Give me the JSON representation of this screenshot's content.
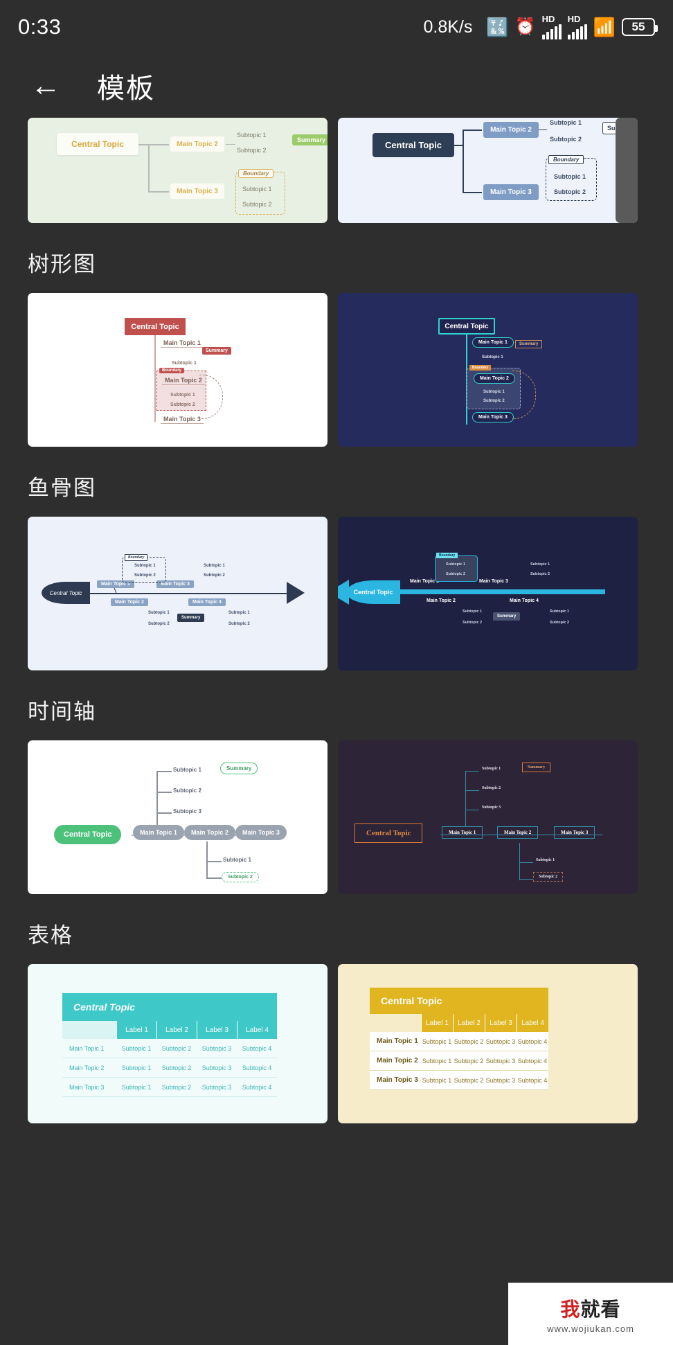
{
  "status_bar": {
    "time": "0:33",
    "net_speed": "0.8K/s",
    "icons": [
      "dnd-moon-icon",
      "bluetooth-icon",
      "alarm-icon",
      "signal-hd-1-icon",
      "signal-hd-2-icon",
      "wifi-icon",
      "battery-icon"
    ],
    "hd_label_1": "HD",
    "hd_label_2": "HD",
    "battery_percent": "55"
  },
  "app_bar": {
    "back_icon": "back-arrow-icon",
    "title": "模板"
  },
  "sections": [
    {
      "id": "mindmap-partial",
      "title": "",
      "cards": [
        {
          "id": "mindmap-green",
          "theme_bg": "#e8f0e4",
          "central": "Central Topic",
          "mains": [
            "Main Topic 2",
            "Main Topic 3"
          ],
          "subs": [
            "Subtopic 1",
            "Subtopic 2",
            "Subtopic 1",
            "Subtopic 2"
          ],
          "summary": "Summary",
          "boundary": "Boundary"
        },
        {
          "id": "mindmap-blue",
          "theme_bg": "#eef3fb",
          "central": "Central Topic",
          "mains": [
            "Main Topic 2",
            "Main Topic 3"
          ],
          "subs": [
            "Subtopic 1",
            "Subtopic 2",
            "Subtopic 1",
            "Subtopic 2"
          ],
          "summary": "Summary",
          "boundary": "Boundary"
        }
      ]
    },
    {
      "id": "tree",
      "title": "树形图",
      "cards": [
        {
          "id": "tree-light",
          "theme_bg": "#ffffff",
          "accent": "#c0504d",
          "central": "Central Topic",
          "mains": [
            "Main Topic 1",
            "Main Topic 2",
            "Main Topic 3"
          ],
          "subs": [
            "Subtopic 1",
            "Subtopic 1",
            "Subtopic 2"
          ],
          "summary": "Summary",
          "boundary": "Boundary"
        },
        {
          "id": "tree-dark",
          "theme_bg": "#262b5e",
          "accent": "#2fd4cf",
          "central": "Central Topic",
          "mains": [
            "Main Topic 1",
            "Main Topic 2",
            "Main Topic 3"
          ],
          "subs": [
            "Subtopic 1",
            "Subtopic 1",
            "Subtopic 2"
          ],
          "summary": "Summary",
          "boundary": "Boundary"
        }
      ]
    },
    {
      "id": "fishbone",
      "title": "鱼骨图",
      "cards": [
        {
          "id": "fishbone-light",
          "theme_bg": "#edf2fa",
          "accent": "#2e3a52",
          "central": "Central Topic",
          "mains": [
            "Main Topic 1",
            "Main Topic 3",
            "Main Topic 2",
            "Main Topic 4"
          ],
          "subs": [
            "Subtopic 1",
            "Subtopic 2"
          ],
          "summary": "Summary",
          "boundary": "Boundary"
        },
        {
          "id": "fishbone-dark",
          "theme_bg": "#1e2142",
          "accent": "#2ab6e0",
          "central": "Central Topic",
          "mains": [
            "Main Topic 1",
            "Main Topic 3",
            "Main Topic 2",
            "Main Topic 4"
          ],
          "subs": [
            "Subtopic 1",
            "Subtopic 2"
          ],
          "summary": "Summary",
          "boundary": "Boundary"
        }
      ]
    },
    {
      "id": "timeline",
      "title": "时间轴",
      "cards": [
        {
          "id": "timeline-light",
          "theme_bg": "#ffffff",
          "accent": "#4cc17a",
          "central": "Central Topic",
          "mains": [
            "Main Topic 1",
            "Main Topic 2",
            "Main Topic 3"
          ],
          "subs": [
            "Subtopic 1",
            "Subtopic 2",
            "Subtopic 3",
            "Subtopic 1",
            "Subtopic 2"
          ],
          "summary": "Summary"
        },
        {
          "id": "timeline-dark",
          "theme_bg": "#2e2438",
          "accent": "#d97a36",
          "central": "Central Topic",
          "mains": [
            "Main Topic 1",
            "Main Topic 2",
            "Main Topic 3"
          ],
          "subs": [
            "Subtopic 1",
            "Subtopic 2",
            "Subtopic 3",
            "Subtopic 1",
            "Subtopic 2"
          ],
          "summary": "Summary"
        }
      ]
    },
    {
      "id": "table",
      "title": "表格",
      "cards": [
        {
          "id": "table-teal",
          "theme_bg": "#f0fbfa",
          "accent": "#3ec8c8",
          "title_cell": "Central Topic",
          "col_headers": [
            "Label 1",
            "Label 2",
            "Label 3",
            "Label 4"
          ],
          "rows": [
            {
              "head": "Main Topic 1",
              "cells": [
                "Subtopic 1",
                "Subtopic 2",
                "Subtopic 3",
                "Subtopic 4"
              ]
            },
            {
              "head": "Main Topic 2",
              "cells": [
                "Subtopic 1",
                "Subtopic 2",
                "Subtopic 3",
                "Subtopic 4"
              ]
            },
            {
              "head": "Main Topic 3",
              "cells": [
                "Subtopic 1",
                "Subtopic 2",
                "Subtopic 3",
                "Subtopic 4"
              ]
            }
          ]
        },
        {
          "id": "table-gold",
          "theme_bg": "#f6ecc9",
          "accent": "#e0b51f",
          "title_cell": "Central Topic",
          "col_headers": [
            "Label 1",
            "Label 2",
            "Label 3",
            "Label 4"
          ],
          "rows": [
            {
              "head": "Main Topic 1",
              "cells": [
                "Subtopic 1",
                "Subtopic 2",
                "Subtopic 3",
                "Subtopic 4"
              ]
            },
            {
              "head": "Main Topic 2",
              "cells": [
                "Subtopic 1",
                "Subtopic 2",
                "Subtopic 3",
                "Subtopic 4"
              ]
            },
            {
              "head": "Main Topic 3",
              "cells": [
                "Subtopic 1",
                "Subtopic 2",
                "Subtopic 3",
                "Subtopic 4"
              ]
            }
          ]
        }
      ]
    }
  ],
  "watermark": {
    "prefix": "我",
    "rest": "就看",
    "url": "www.wojiukan.com"
  }
}
